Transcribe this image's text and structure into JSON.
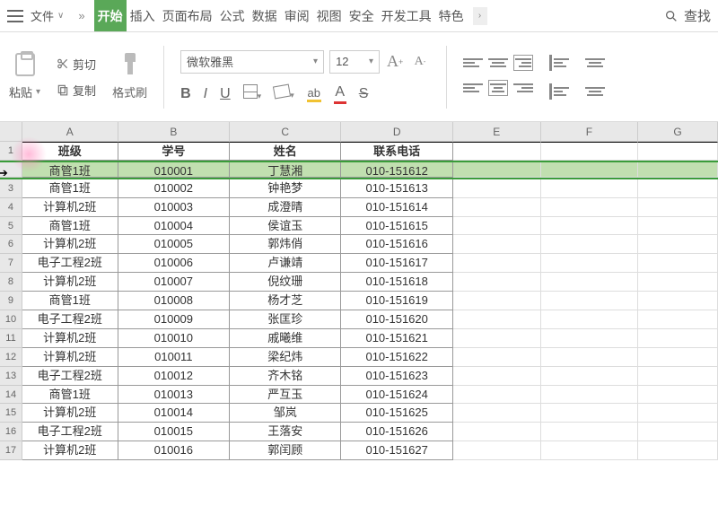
{
  "menu": {
    "file": "文件",
    "tabs": [
      "开始",
      "插入",
      "页面布局",
      "公式",
      "数据",
      "审阅",
      "视图",
      "安全",
      "开发工具",
      "特色"
    ],
    "search": "查找"
  },
  "ribbon": {
    "paste": "粘贴",
    "cut": "剪切",
    "copy": "复制",
    "fmtpaint": "格式刷",
    "font": "微软雅黑",
    "size": "12",
    "bold": "B",
    "italic": "I",
    "underline": "U",
    "strike": "S",
    "fontA": "A"
  },
  "cols": [
    "A",
    "B",
    "C",
    "D",
    "E",
    "F",
    "G"
  ],
  "chart_data": {
    "type": "table",
    "headers": [
      "班级",
      "学号",
      "姓名",
      "联系电话"
    ],
    "rows": [
      [
        "商管1班",
        "010001",
        "丁慧湘",
        "010-151612"
      ],
      [
        "商管1班",
        "010002",
        "钟艳梦",
        "010-151613"
      ],
      [
        "计算机2班",
        "010003",
        "成澄晴",
        "010-151614"
      ],
      [
        "商管1班",
        "010004",
        "侯谊玉",
        "010-151615"
      ],
      [
        "计算机2班",
        "010005",
        "郭炜俏",
        "010-151616"
      ],
      [
        "电子工程2班",
        "010006",
        "卢谦靖",
        "010-151617"
      ],
      [
        "计算机2班",
        "010007",
        "倪纹珊",
        "010-151618"
      ],
      [
        "商管1班",
        "010008",
        "杨才芝",
        "010-151619"
      ],
      [
        "电子工程2班",
        "010009",
        "张匡珍",
        "010-151620"
      ],
      [
        "计算机2班",
        "010010",
        "戚曦维",
        "010-151621"
      ],
      [
        "计算机2班",
        "010011",
        "梁纪炜",
        "010-151622"
      ],
      [
        "电子工程2班",
        "010012",
        "齐木铭",
        "010-151623"
      ],
      [
        "商管1班",
        "010013",
        "严互玉",
        "010-151624"
      ],
      [
        "计算机2班",
        "010014",
        "邹岚",
        "010-151625"
      ],
      [
        "电子工程2班",
        "010015",
        "王落安",
        "010-151626"
      ],
      [
        "计算机2班",
        "010016",
        "郭闰顾",
        "010-151627"
      ]
    ]
  }
}
